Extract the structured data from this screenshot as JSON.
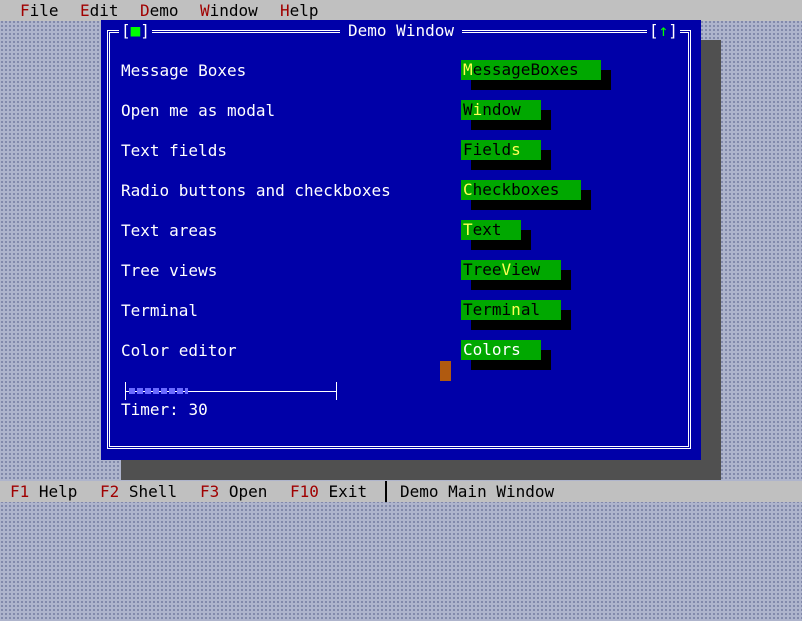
{
  "menubar": {
    "items": [
      {
        "hotkey": "F",
        "rest": "ile"
      },
      {
        "hotkey": "E",
        "rest": "dit"
      },
      {
        "hotkey": "D",
        "rest": "emo"
      },
      {
        "hotkey": "W",
        "rest": "indow"
      },
      {
        "hotkey": "H",
        "rest": "elp"
      }
    ]
  },
  "window": {
    "title": "Demo Window",
    "close_glyph": "■",
    "max_glyph": "↑"
  },
  "rows": [
    {
      "label": "Message Boxes",
      "button": {
        "pre": "",
        "accel": "M",
        "post": "essageBoxes"
      }
    },
    {
      "label": "Open me as modal",
      "button": {
        "pre": "W",
        "accel": "i",
        "post": "ndow"
      }
    },
    {
      "label": "Text fields",
      "button": {
        "pre": "Field",
        "accel": "s",
        "post": ""
      }
    },
    {
      "label": "Radio buttons and checkboxes",
      "button": {
        "pre": "",
        "accel": "C",
        "post": "heckboxes"
      }
    },
    {
      "label": "Text areas",
      "button": {
        "pre": "",
        "accel": "T",
        "post": "ext"
      }
    },
    {
      "label": "Tree views",
      "button": {
        "pre": "Tree",
        "accel": "V",
        "post": "iew"
      }
    },
    {
      "label": "Terminal",
      "button": {
        "pre": "Termi",
        "accel": "n",
        "post": "al"
      }
    },
    {
      "label": "Color editor",
      "button": {
        "pre": "Colors",
        "accel": "",
        "post": ""
      }
    }
  ],
  "slider": {
    "value_fraction": 0.28
  },
  "timer": {
    "label": "Timer:",
    "value": "30"
  },
  "statusbar": {
    "items": [
      {
        "key": "F1",
        "label": "Help"
      },
      {
        "key": "F2",
        "label": "Shell"
      },
      {
        "key": "F3",
        "label": "Open"
      },
      {
        "key": "F10",
        "label": "Exit"
      }
    ],
    "message": "Demo Main Window"
  },
  "colors": {
    "desktop": "#aeb4cc",
    "window_bg": "#0000a8",
    "button_bg": "#00a800",
    "accelerator": "#ffff55",
    "menu_hotkey": "#a00000"
  }
}
